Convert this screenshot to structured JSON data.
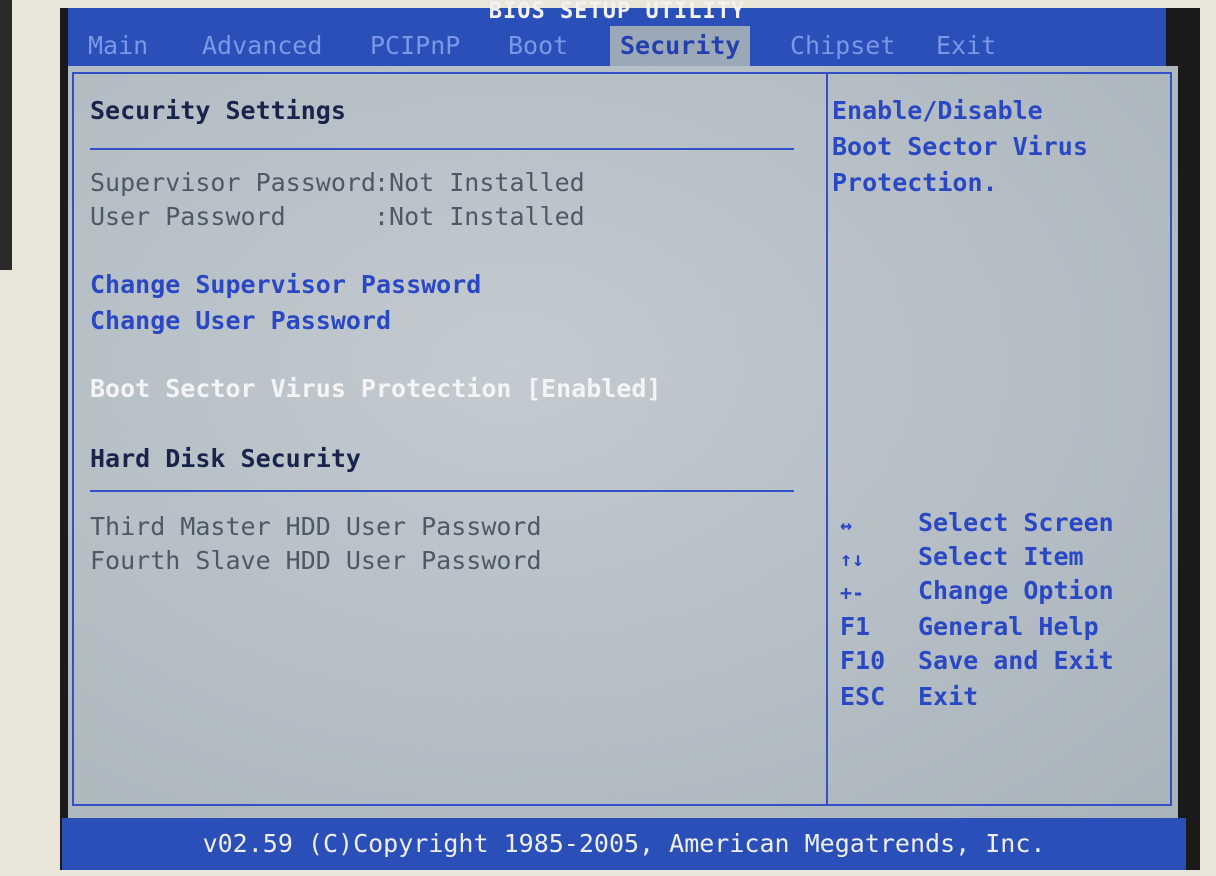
{
  "window": {
    "title": "BIOS SETUP UTILITY"
  },
  "tabs": [
    {
      "label": "Main",
      "active": false
    },
    {
      "label": "Advanced",
      "active": false
    },
    {
      "label": "PCIPnP",
      "active": false
    },
    {
      "label": "Boot",
      "active": false
    },
    {
      "label": "Security",
      "active": true
    },
    {
      "label": "Chipset",
      "active": false
    },
    {
      "label": "Exit",
      "active": false
    }
  ],
  "main": {
    "security_heading": "Security Settings",
    "supervisor_password": {
      "label": "Supervisor Password",
      "value": ":Not Installed"
    },
    "user_password": {
      "label": "User Password",
      "value": ":Not Installed"
    },
    "change_supervisor_password": "Change Supervisor Password",
    "change_user_password": "Change User Password",
    "boot_sector_virus_protection": {
      "label": "Boot Sector Virus Protection",
      "value": "[Enabled]"
    },
    "hdd_heading": "Hard Disk Security",
    "hdd_items": [
      "Third Master HDD User Password",
      "Fourth Slave HDD User Password"
    ]
  },
  "help": {
    "description_lines": [
      "Enable/Disable",
      "Boot Sector Virus",
      "Protection."
    ],
    "keys": [
      {
        "key": "↔",
        "action": "Select Screen"
      },
      {
        "key": "↑↓",
        "action": "Select Item"
      },
      {
        "key": "+-",
        "action": "Change Option"
      },
      {
        "key": "F1",
        "action": "General Help"
      },
      {
        "key": "F10",
        "action": "Save and Exit"
      },
      {
        "key": "ESC",
        "action": "Exit"
      }
    ]
  },
  "footer": {
    "copyright": "v02.59 (C)Copyright 1985-2005, American Megatrends, Inc."
  },
  "colors": {
    "header_blue": "#2a4fb8",
    "panel_gray": "#b9c1c8",
    "accent_blue": "#3350c8",
    "highlight_text": "#f4f4f4"
  }
}
